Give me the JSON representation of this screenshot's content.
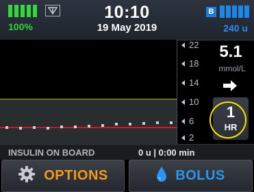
{
  "status": {
    "battery_percent": "100%",
    "time": "10:10",
    "date": "19 May 2019",
    "bluetooth_badge": "B",
    "reservoir_units": "240 u",
    "battery_level": 1.0,
    "reservoir_level": 1.0,
    "icons": [
      "battery-icon",
      "signal-icon",
      "bluetooth-icon",
      "reservoir-icon"
    ]
  },
  "graph": {
    "y_ticks": [
      "22",
      "18",
      "14",
      "10",
      "6",
      "2"
    ],
    "colors": {
      "target_band": "#2a2d30",
      "high_line": "#c9a634",
      "low_line": "#c31f27"
    }
  },
  "sensor": {
    "value": "5.1",
    "unit": "mmol/L",
    "trend_icon": "arrow-right-icon"
  },
  "time_range_button": {
    "number": "1",
    "unit": "HR"
  },
  "insulin_on_board": {
    "label": "INSULIN ON BOARD",
    "value": "0 u | 0:00 min"
  },
  "buttons": {
    "options": {
      "label": "OPTIONS",
      "icon": "gear-icon",
      "color": "#f49a1c"
    },
    "bolus": {
      "label": "BOLUS",
      "icon": "drop-icon",
      "color": "#2c95f2"
    }
  }
}
